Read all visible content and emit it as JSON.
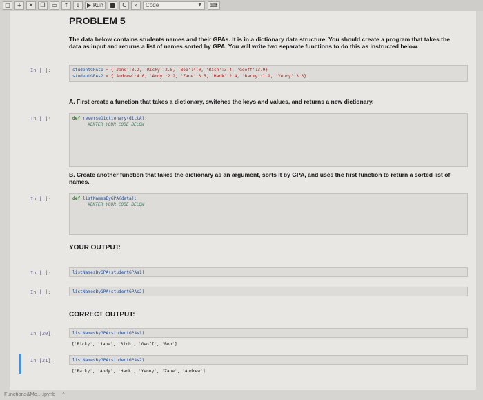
{
  "toolbar": {
    "run_label": "Run",
    "cell_type": "Code"
  },
  "title": "PROBLEM 5",
  "intro": "The data below contains students names and their GPAs. It is in a dictionary data structure. You should create a program that takes the data as input and returns a list of names sorted by GPA. You will write two separate functions to do this as instructed below.",
  "cells": {
    "data": {
      "prompt": "In [ ]:",
      "line1_var": "studentGPAs1",
      "line1_val": "= {'Jane':3.2, 'Ricky':2.5, 'Bob':4.0, 'Rich':3.4, 'Geoff':3.9}",
      "line2_var": "studentGPAs2",
      "line2_val": "= {'Andrew':4.0, 'Andy':2.2, 'Zane':3.5, 'Hank':2.4, 'Barky':1.9, 'Yenny':3.3}"
    },
    "a_instruction": "A. First create a function that takes a dictionary, switches the keys and values, and returns a new dictionary.",
    "a_code": {
      "prompt": "In [ ]:",
      "kw": "def",
      "sig": "reverseDictionary(dictA):",
      "comment": "#ENTER YOUR CODE BELOW"
    },
    "b_instruction": "B. Create another function that takes the dictionary as an argument, sorts it by GPA, and uses the first function to return a sorted list of names.",
    "b_code": {
      "prompt": "In [ ]:",
      "kw": "def",
      "sig": "listNamesByGPA(data):",
      "comment": "#ENTER YOUR CODE BELOW"
    },
    "your_output_heading": "YOUR OUTPUT:",
    "yo1": {
      "prompt": "In [ ]:",
      "code": "listNamesByGPA(studentGPAs1)"
    },
    "yo2": {
      "prompt": "In [ ]:",
      "code": "listNamesByGPA(studentGPAs2)"
    },
    "correct_output_heading": "CORRECT OUTPUT:",
    "co1": {
      "prompt": "In [20]:",
      "code": "listNamesByGPA(studentGPAs1)",
      "output": "['Ricky', 'Jane', 'Rich', 'Geoff', 'Bob']"
    },
    "co2": {
      "prompt": "In [21]:",
      "code": "listNamesByGPA(studentGPAs2)",
      "output": "['Barky', 'Andy', 'Hank', 'Yenny', 'Zane', 'Andrew']"
    }
  },
  "status": {
    "filename": "Functions&Mo....ipynb"
  }
}
